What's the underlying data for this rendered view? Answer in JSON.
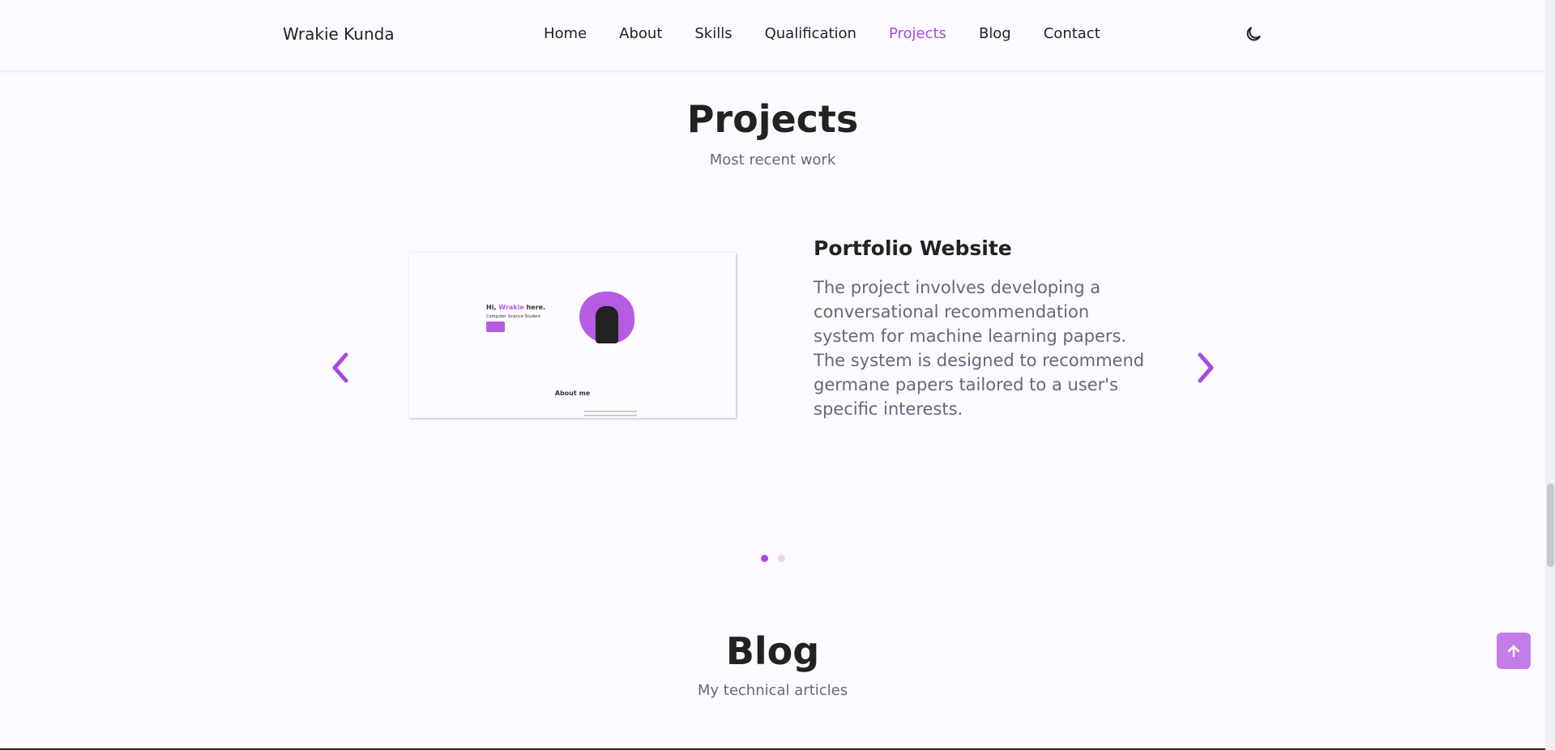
{
  "header": {
    "logo": "Wrakie Kunda",
    "nav": [
      "Home",
      "About",
      "Skills",
      "Qualification",
      "Projects",
      "Blog",
      "Contact"
    ],
    "active": "Projects",
    "theme_icon": "moon-icon"
  },
  "projects": {
    "title": "Projects",
    "subtitle": "Most recent work",
    "item": {
      "title": "Portfolio Website",
      "description": "The project involves developing a conversational recommendation system for machine learning papers. The system is designed to recommend germane papers tailored to a user's specific interests.",
      "screenshot": {
        "greeting_pre": "Hi, ",
        "greeting_name": "Wrakie",
        "greeting_post": " here.",
        "role": "Computer Science Student",
        "about": "About me"
      }
    },
    "slide_count": 2,
    "active_slide": 1
  },
  "blog": {
    "title": "Blog",
    "subtitle": "My technical articles"
  },
  "colors": {
    "accent": "#a54ce0",
    "background": "#fcfaff"
  }
}
